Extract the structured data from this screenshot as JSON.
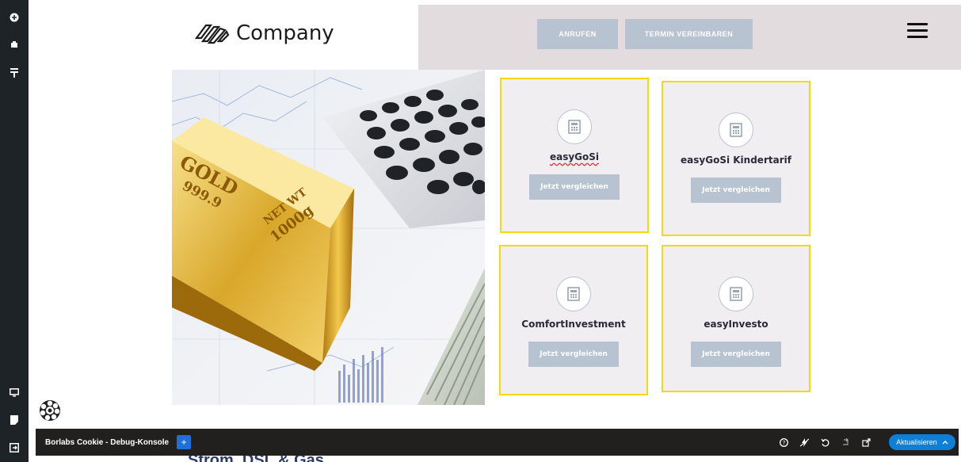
{
  "header": {
    "logo_text": "Company",
    "call_button": "ANRUFEN",
    "appointment_button": "TERMIN VEREINBAREN"
  },
  "cards": [
    {
      "title": "easyGoSi",
      "button": "Jetzt vergleichen"
    },
    {
      "title": "easyGoSi Kindertarif",
      "button": "Jetzt vergleichen"
    },
    {
      "title": "ComfortInvestment",
      "button": "Jetzt vergleichen"
    },
    {
      "title": "easyInvesto",
      "button": "Jetzt vergleichen"
    }
  ],
  "debug_console": {
    "title": "Borlabs Cookie - Debug-Konsole",
    "plus": "+",
    "update_button": "Aktualisieren"
  },
  "bottom_heading": "Strom, DSL & Gas",
  "hero_image": {
    "gold_bar_text_1": "GOLD",
    "gold_bar_text_2": "999.9",
    "gold_bar_text_3": "NET WT",
    "gold_bar_text_4": "1000g"
  },
  "colors": {
    "sidebar": "#1d2327",
    "header_right_bg": "#e2dcde",
    "button_bg": "#b7c3d1",
    "card_border": "#f5d90a",
    "card_bg": "#f0eef0",
    "debug_bg": "#22201f",
    "update_btn": "#0d7fd6"
  }
}
